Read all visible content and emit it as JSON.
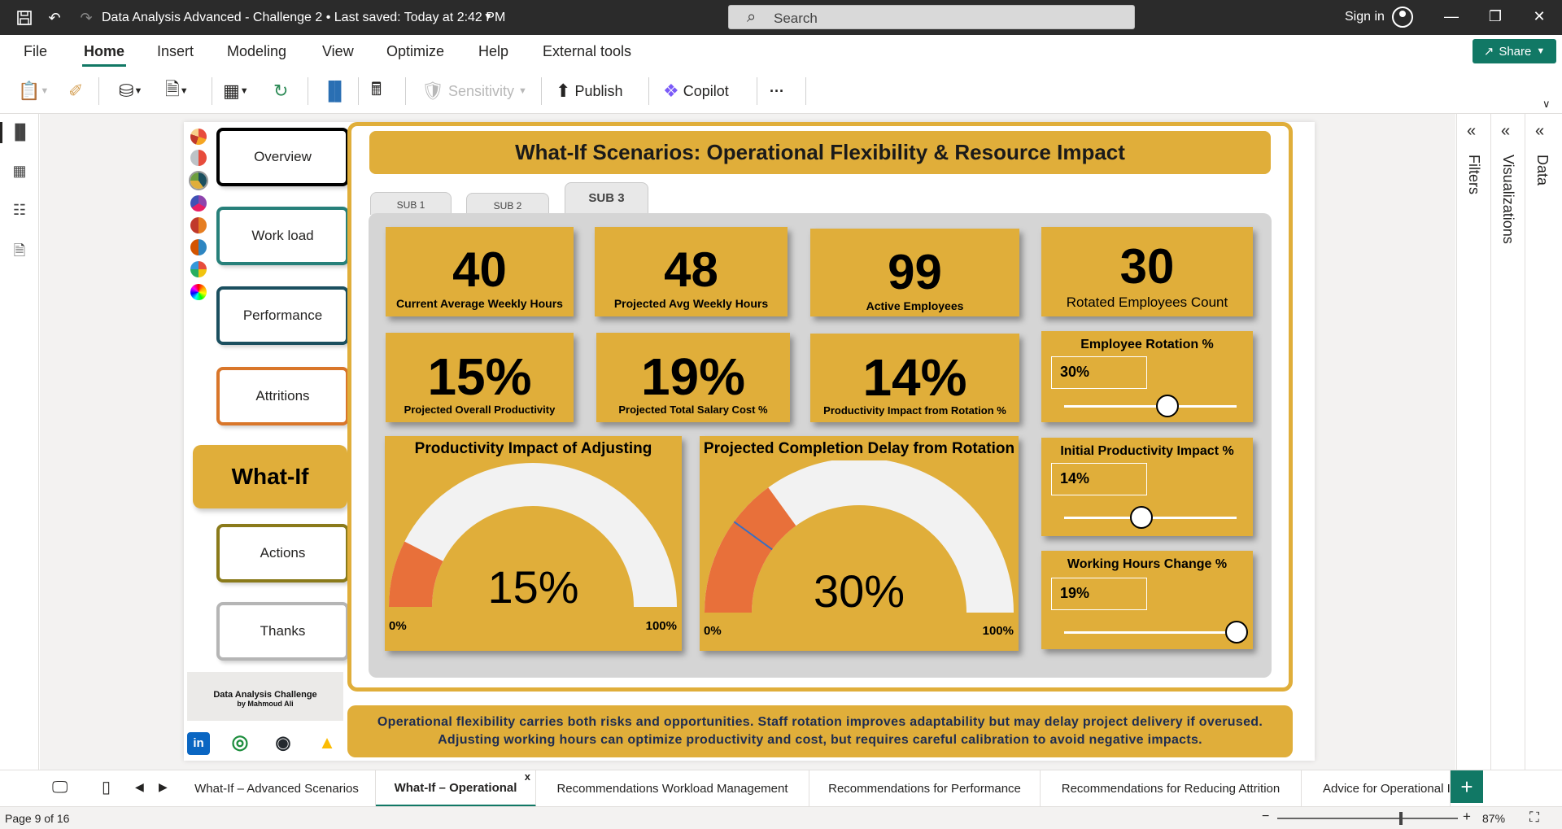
{
  "titlebar": {
    "doc_title": "Data Analysis Advanced - Challenge 2 • Last saved: Today at 2:42 PM",
    "search_placeholder": "Search",
    "sign_in": "Sign in"
  },
  "menu": {
    "items": [
      "File",
      "Home",
      "Insert",
      "Modeling",
      "View",
      "Optimize",
      "Help",
      "External tools"
    ],
    "active": "Home",
    "share_label": "Share"
  },
  "ribbon": {
    "sensitivity": "Sensitivity",
    "publish": "Publish",
    "copilot": "Copilot",
    "more": "···"
  },
  "right_panes": [
    "Data",
    "Visualizations",
    "Filters"
  ],
  "report": {
    "nav": {
      "items": [
        "Overview",
        "Work load",
        "Performance",
        "Attritions",
        "What-If",
        "Actions",
        "Thanks"
      ],
      "active": "What-If",
      "credit_title": "Data Analysis Challenge",
      "credit_author": "by Mahmoud Ali"
    },
    "banner_title": "What-If Scenarios: Operational Flexibility & Resource Impact",
    "subtabs": [
      "SUB 1",
      "SUB 2",
      "SUB 3"
    ],
    "kpis": [
      {
        "value": "40",
        "label": "Current Average Weekly Hours"
      },
      {
        "value": "48",
        "label": "Projected Avg Weekly Hours"
      },
      {
        "value": "99",
        "label": "Active Employees"
      },
      {
        "value": "30",
        "label": "Rotated Employees Count"
      },
      {
        "value": "15%",
        "label": "Projected Overall Productivity"
      },
      {
        "value": "19%",
        "label": "Projected Total Salary Cost %"
      },
      {
        "value": "14%",
        "label": "Productivity Impact from Rotation %"
      }
    ],
    "sliders": [
      {
        "title": "Employee Rotation %",
        "value": "30%",
        "level": 0.6
      },
      {
        "title": "Initial Productivity Impact %",
        "value": "14%",
        "level": 0.45
      },
      {
        "title": "Working Hours Change %",
        "value": "19%",
        "level": 1.0
      }
    ],
    "gauges": [
      {
        "title": "Productivity Impact of Adjusting",
        "value_label": "15%",
        "value": 15,
        "min_label": "0%",
        "max_label": "100%"
      },
      {
        "title": "Projected Completion Delay from Rotation",
        "value_label": "30%",
        "value": 30,
        "target": 20,
        "min_label": "0%",
        "max_label": "100%"
      }
    ],
    "footer_line1": "Operational flexibility carries both risks and opportunities. Staff rotation improves adaptability but may delay project delivery if overused.",
    "footer_line2": "Adjusting working hours can optimize productivity and cost, but requires careful calibration to avoid negative impacts."
  },
  "page_tabs": {
    "items": [
      "What-If – Advanced Scenarios",
      "What-If – Operational",
      "Recommendations Workload Management",
      "Recommendations for Performance",
      "Recommendations for Reducing Attrition",
      "Advice for Operational I"
    ],
    "active": "What-If – Operational",
    "close_glyph": "x"
  },
  "status": {
    "page_info": "Page 9 of 16",
    "zoom": "87%",
    "zoom_level": 0.87
  },
  "colors": {
    "gold": "#e0ae3a",
    "gauge_fill": "#e8703a",
    "gauge_track": "#f2f2f2",
    "accent_green": "#117865"
  }
}
